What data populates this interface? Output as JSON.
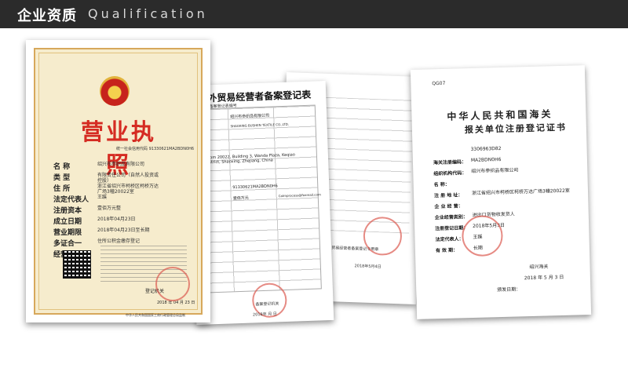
{
  "header": {
    "title": "企业资质",
    "subtitle": "Qualification"
  },
  "license": {
    "title": "营业执照",
    "credit_code": "统一社会信用代码 91330621MA2BDN0H6",
    "fields": [
      {
        "label": "名    称",
        "value": "绍兴布参织品有限公司"
      },
      {
        "label": "类    型",
        "value": "有限责任公司（自然人投资或控股）"
      },
      {
        "label": "住    所",
        "value": "浙江省绍兴市柯桥区柯桥万达广场3幢20022室"
      },
      {
        "label": "法定代表人",
        "value": "王蹊"
      },
      {
        "label": "注册资本",
        "value": "壹佰万元整"
      },
      {
        "label": "成立日期",
        "value": "2018年04月23日"
      },
      {
        "label": "营业期限",
        "value": "2018年04月23日至长期"
      },
      {
        "label": "多证合一",
        "value": "住所公积金缴存登记"
      },
      {
        "label": "经营范围",
        "value": ""
      }
    ],
    "registration_office": "登记机关",
    "date": "2018 年 04 月 23 日",
    "footer": "中华人民共和国国家工商行政管理总局监制"
  },
  "foreign_trade": {
    "title": "对外贸易经营者备案登记表",
    "stamp_label": "备案登记表编号",
    "company_cn": "绍兴布参织品有限公司",
    "company_en": "SHAOXING BUSHEN TEXTILE CO.,LTD.",
    "code": "91330621MA2BDN0H6",
    "address": "Room 20022, Building 3, Wanda Plaza, Keqiao District, Shaoxing, Zhejiang, China",
    "capital": "壹佰万元",
    "phone_label": "电子邮箱",
    "email": "Calmprocess@foxmail.com",
    "date": "2018年 月 日",
    "bottom_label": "备案登记机关"
  },
  "back_sheet": {
    "lines": [
      "对外贸易经营者备案登记专用章",
      "2018年5月4日"
    ]
  },
  "customs": {
    "code": "QG07",
    "title1": "中华人民共和国海关",
    "title2": "报关单位注册登记证书",
    "rows": [
      {
        "label": "",
        "value": "3306963D82"
      },
      {
        "label": "海关注册编码：",
        "value": "MA2BDN0H6"
      },
      {
        "label": "组织机构代码：",
        "value": "绍兴布参织品有限公司"
      },
      {
        "label": "名      称：",
        "value": ""
      },
      {
        "label": "注 册 地 址：",
        "value": "浙江省绍兴市柯桥区柯桥万达广场3幢20022室"
      },
      {
        "label": "企 业 经 营：",
        "value": ""
      },
      {
        "label": "企业经营类别：",
        "value": "进出口货物收发货人"
      },
      {
        "label": "注册登记日期：",
        "value": "2018年5月3日"
      },
      {
        "label": "法定代表人：",
        "value": "王蹊"
      },
      {
        "label": "有 效 期：",
        "value": "长期"
      }
    ],
    "sign": "绍兴海关",
    "date": "2018 年 5 月 3 日",
    "issue_label": "颁发日期："
  }
}
